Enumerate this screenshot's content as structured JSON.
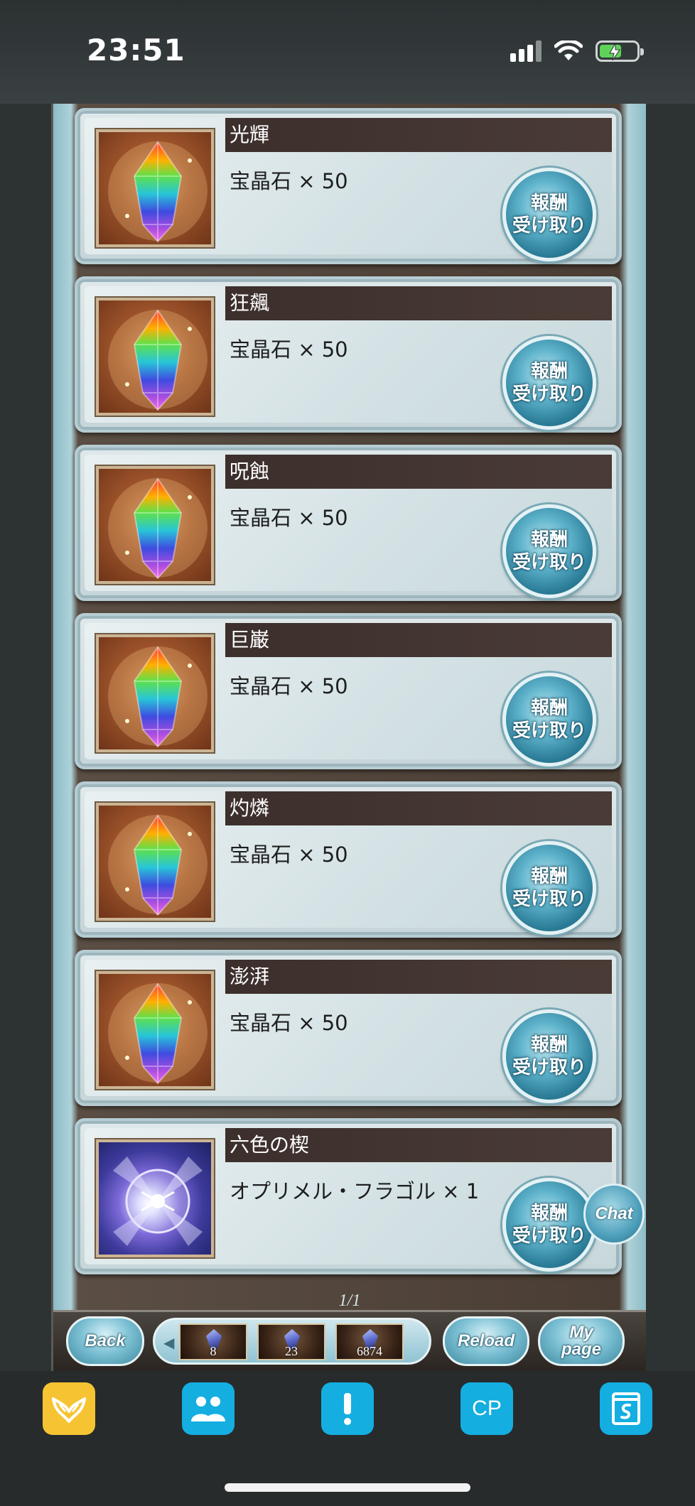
{
  "status_bar": {
    "time": "23:51"
  },
  "rewards": [
    {
      "title": "光輝",
      "item": "宝晶石 × 50",
      "icon": "rainbow-crystal-icon"
    },
    {
      "title": "狂飆",
      "item": "宝晶石 × 50",
      "icon": "rainbow-crystal-icon"
    },
    {
      "title": "呪蝕",
      "item": "宝晶石 × 50",
      "icon": "rainbow-crystal-icon"
    },
    {
      "title": "巨巌",
      "item": "宝晶石 × 50",
      "icon": "rainbow-crystal-icon"
    },
    {
      "title": "灼燐",
      "item": "宝晶石 × 50",
      "icon": "rainbow-crystal-icon"
    },
    {
      "title": "澎湃",
      "item": "宝晶石 × 50",
      "icon": "rainbow-crystal-icon"
    },
    {
      "title": "六色の楔",
      "item": "オプリメル・フラゴル × 1",
      "icon": "prism-orb-icon"
    }
  ],
  "claim_button": {
    "line1": "報酬",
    "line2": "受け取り"
  },
  "chat_button": "Chat",
  "pager": "1/1",
  "game_nav": {
    "back": "Back",
    "reload": "Reload",
    "mypage_line1": "My",
    "mypage_line2": "page",
    "items": [
      "8",
      "23",
      "6874"
    ]
  },
  "toolbar": {
    "buttons": [
      "wing-icon",
      "friends-icon",
      "alert-icon",
      "cp-icon",
      "sheet-icon"
    ],
    "cp_label": "CP",
    "colors": {
      "yellow": "#f6c433",
      "blue": "#14aee0"
    }
  }
}
